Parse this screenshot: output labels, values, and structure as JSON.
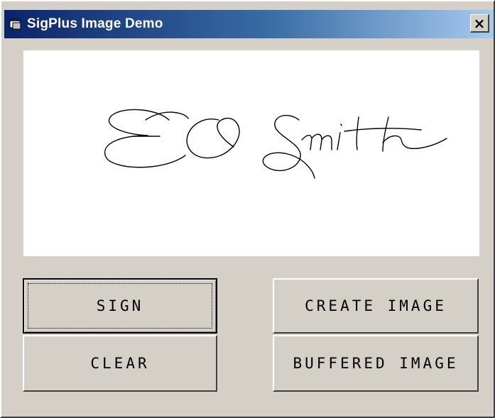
{
  "window": {
    "title": "SigPlus Image Demo",
    "close_label": "×",
    "app_icon": "app-window-icon",
    "close_icon": "close-icon"
  },
  "signature": {
    "text": "EO Smith"
  },
  "buttons": {
    "sign": "SIGN",
    "clear": "CLEAR",
    "create_image": "CREATE IMAGE",
    "buffered_image": "BUFFERED IMAGE"
  },
  "colors": {
    "face": "#d4d0c8",
    "titlebar_start": "#0a246a",
    "titlebar_end": "#a6caf0",
    "ink": "#000000"
  }
}
